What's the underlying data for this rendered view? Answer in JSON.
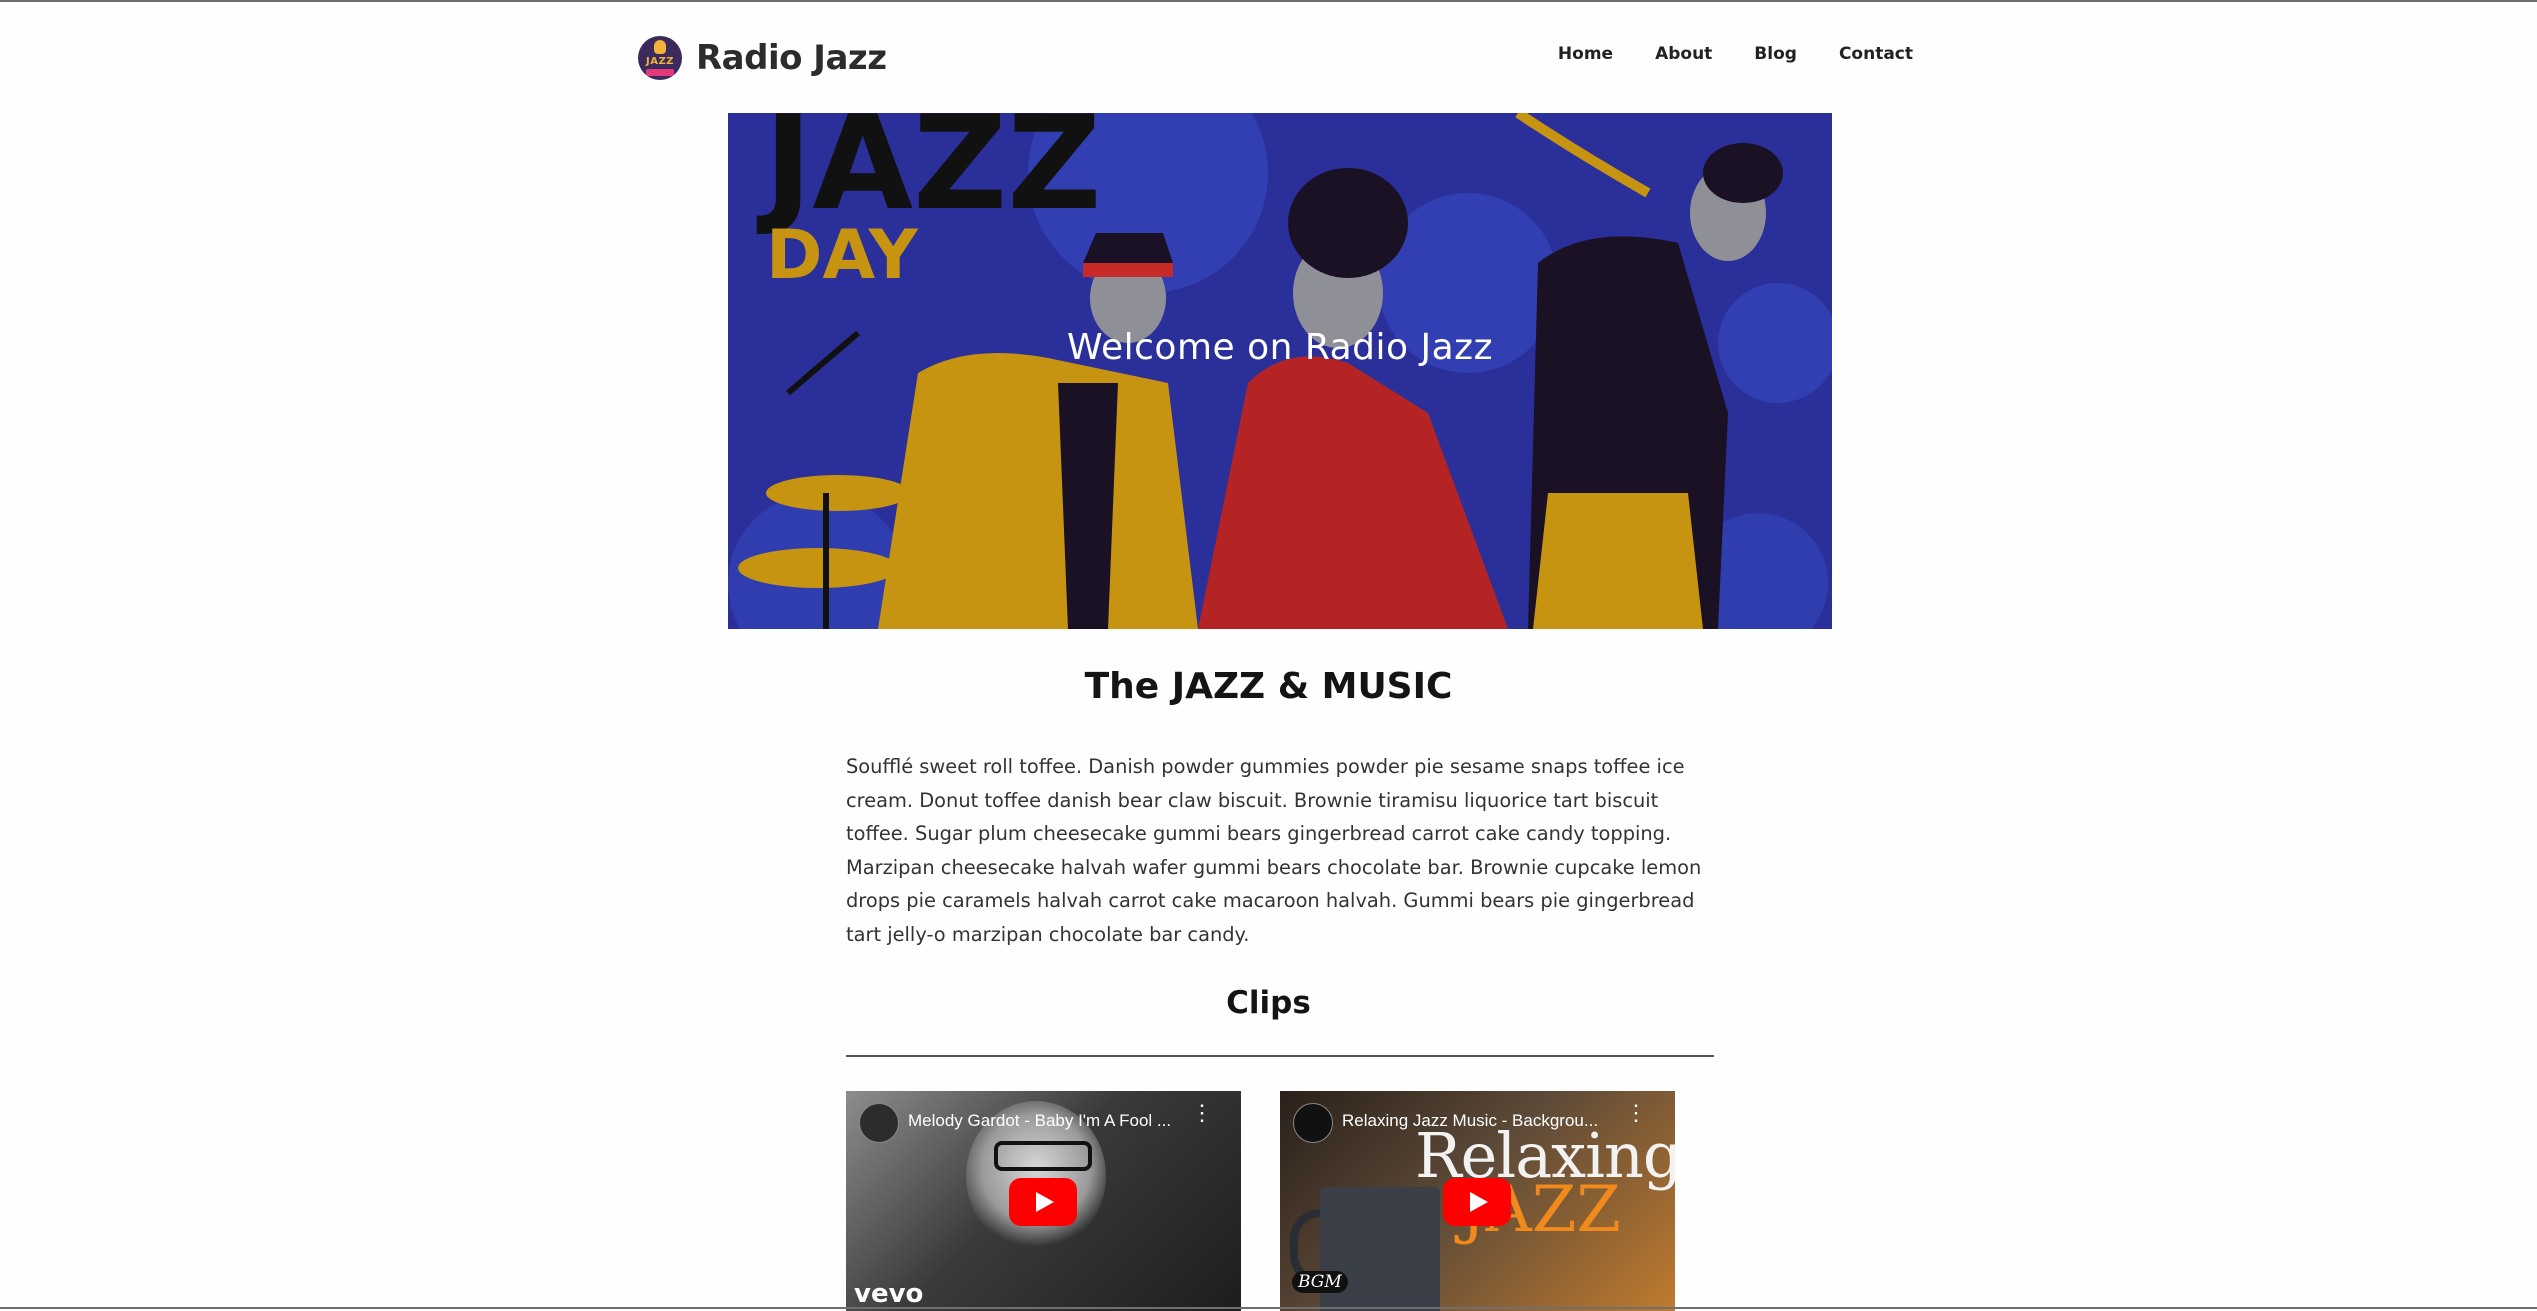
{
  "brand": {
    "name": "Radio Jazz",
    "logo_text": "JAZZ",
    "logo_icon": "jazz-microphone-logo"
  },
  "nav": {
    "items": [
      "Home",
      "About",
      "Blog",
      "Contact"
    ]
  },
  "hero": {
    "title": "Welcome on Radio Jazz",
    "illustration_text": [
      "JAZZ",
      "DAY"
    ],
    "colors": {
      "background": "#2a2f9a",
      "accent_yellow": "#d89a12",
      "accent_red": "#b02a2a"
    }
  },
  "main": {
    "heading": "The JAZZ & MUSIC",
    "paragraph": "Soufflé sweet roll toffee. Danish powder gummies powder pie sesame snaps toffee ice cream. Donut toffee danish bear claw biscuit. Brownie tiramisu liquorice tart biscuit toffee. Sugar plum cheesecake gummi bears gingerbread carrot cake candy topping. Marzipan cheesecake halvah wafer gummi bears chocolate bar. Brownie cupcake lemon drops pie caramels halvah carrot cake macaroon halvah. Gummi bears pie gingerbread tart jelly-o marzipan chocolate bar candy.",
    "clips_heading": "Clips"
  },
  "videos": [
    {
      "title": "Melody Gardot - Baby I'm A Fool ...",
      "overlay_text": "vevo",
      "menu": "⋮"
    },
    {
      "title": "Relaxing Jazz Music - Backgrou...",
      "overlay_text": "Relaxing",
      "overlay_text_2": "JAZZ",
      "badge": "BGM",
      "menu": "⋮"
    }
  ]
}
